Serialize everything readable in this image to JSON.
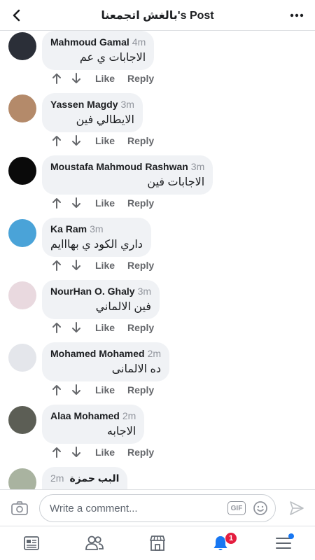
{
  "header": {
    "title": "بالغش اتجمعنا's Post",
    "back_icon": "chevron-left-icon",
    "more_icon": "more-dots-icon"
  },
  "actions": {
    "like": "Like",
    "reply": "Reply"
  },
  "comments": [
    {
      "name": "Mahmoud Gamal",
      "time": "4m",
      "text": "الاجابات ي عم",
      "avatar": "#2b2f38"
    },
    {
      "name": "Yassen Magdy",
      "time": "3m",
      "text": "الايطالي فين",
      "avatar": "#b48a6a"
    },
    {
      "name": "Moustafa Mahmoud Rashwan",
      "time": "3m",
      "text": "الاجابات فين",
      "avatar": "#0a0a0a"
    },
    {
      "name": "Ka Ram",
      "time": "3m",
      "text": "داري الكود ي بهااايم",
      "avatar": "#4aa3d8"
    },
    {
      "name": "NourHan O. Ghaly",
      "time": "3m",
      "text": "فين الالماني",
      "avatar": "#e9d9df"
    },
    {
      "name": "Mohamed Mohamed",
      "time": "2m",
      "text": "ده الالمانى",
      "avatar": "#e4e6eb"
    },
    {
      "name": "Alaa Mohamed",
      "time": "2m",
      "text": "الاجابه",
      "avatar": "#5c5e55"
    },
    {
      "name": "البب حمزة",
      "time": "2m",
      "text": "",
      "avatar": "#a9b3a0"
    }
  ],
  "composer": {
    "placeholder": "Write a comment...",
    "gif_label": "GIF"
  },
  "nav": {
    "notifications_badge": "1",
    "accent": "#1877f2"
  }
}
